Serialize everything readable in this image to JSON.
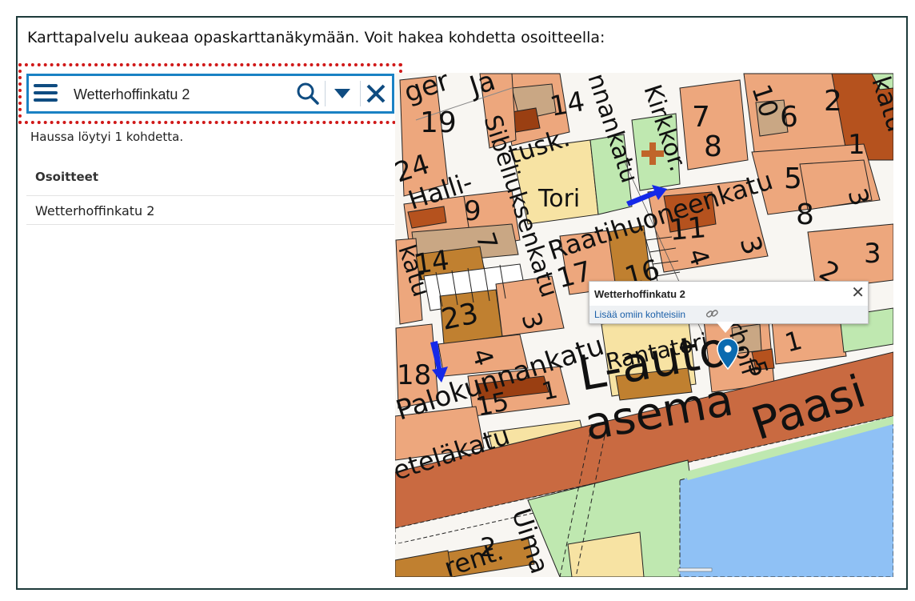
{
  "instruction": "Karttapalvelu aukeaa opaskarttanäkymään. Voit hakea kohdetta osoitteella:",
  "search": {
    "value": "Wetterhoffinkatu 2",
    "menu_icon": "hamburger-menu-icon",
    "search_icon": "search-icon",
    "dropdown_icon": "caret-down-icon",
    "clear_icon": "close-icon"
  },
  "results": {
    "summary": "Haussa löytyi 1 kohdetta.",
    "header": "Osoitteet",
    "items": [
      "Wetterhoffinkatu 2"
    ]
  },
  "popup": {
    "title": "Wetterhoffinkatu 2",
    "link": "Lisää omiin kohteisiin",
    "close_symbol": "✕",
    "link_icon": "link-icon"
  },
  "map": {
    "labels": {
      "ger": "ger",
      "ja": "Ja",
      "s19": "19",
      "s14": "14",
      "kirkkor": "Kirkkor.",
      "s7": "7",
      "s8top": "8",
      "s10": "10",
      "s6": "6",
      "s2top": "2",
      "katuTR": "katu",
      "s1": "1",
      "s24": "24",
      "tusk": "tusk.",
      "sibeliuksenkatu": "Sibeliuksenkatu",
      "nnankatu": "nnankatu",
      "s8": "8",
      "s5": "5",
      "s3r": "3",
      "halli": "Halli-",
      "tori": "Tori",
      "raatihuoneenkatu": "Raatihuoneenkatu",
      "s9": "9",
      "s8b": "8",
      "s11": "11",
      "s3": "3",
      "s4": "4",
      "s7b": "7",
      "s14b": "14",
      "katuL": "katu",
      "s17": "17",
      "s16": "16",
      "s2": "2",
      "s3b": "3",
      "s23": "23",
      "s3c": "3",
      "rantatori": "Rantatori",
      "s4b": "4",
      "s5b": "5",
      "tteroff": "tterhoff",
      "s1b": "1",
      "s18": "18",
      "palokunnankatu": "Palokunnankatu",
      "lauto": "L-auto-",
      "asema": "asema",
      "paasi": "Paasi",
      "s15": "15",
      "s1c": "1",
      "etelakatu": "eteläkatu",
      "s2c": "2",
      "uima": "Uima",
      "rent": "rent."
    },
    "colors": {
      "salmon": "#eda77d",
      "brown": "#b5521e",
      "darkbrown": "#9a3f12",
      "tan": "#c9a784",
      "yellow": "#f7e3a3",
      "green": "#bfe8b0",
      "road": "#f8f6f2",
      "main_road": "#c96a41",
      "water": "#8fc1f5",
      "arrow": "#1529e8",
      "pin": "#0a6ab0",
      "cross": "#c0652a"
    }
  }
}
